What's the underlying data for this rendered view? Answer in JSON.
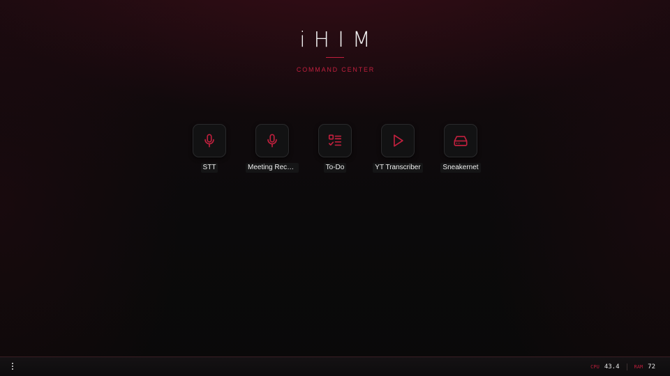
{
  "header": {
    "title": "iHIM",
    "subtitle": "COMMAND CENTER"
  },
  "apps": [
    {
      "label": "STT",
      "icon": "microphone-icon"
    },
    {
      "label": "Meeting Recor...",
      "icon": "microphone-icon"
    },
    {
      "label": "To-Do",
      "icon": "checklist-icon"
    },
    {
      "label": "YT Transcriber",
      "icon": "play-icon"
    },
    {
      "label": "Sneakernet",
      "icon": "hard-drive-icon"
    }
  ],
  "taskbar": {
    "menu_icon": "vertical-dots-icon",
    "cpu_label": "CPU",
    "cpu_value": "43.4",
    "ram_label": "RAM",
    "ram_value": "72"
  },
  "colors": {
    "accent": "#c2203e",
    "tile_background": "#121213",
    "text": "#f0f0f0"
  }
}
